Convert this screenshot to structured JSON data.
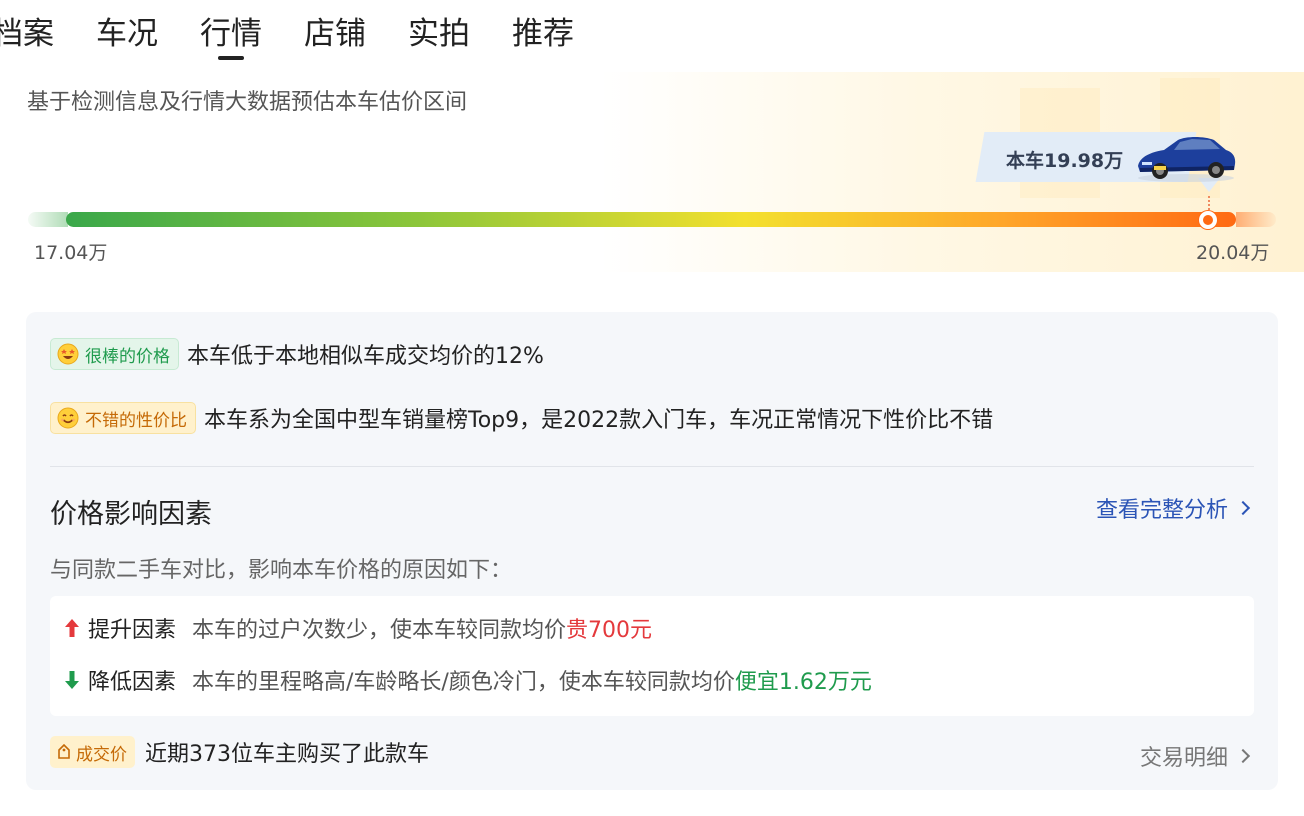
{
  "tabs": [
    {
      "label": "档案",
      "active": false
    },
    {
      "label": "车况",
      "active": false
    },
    {
      "label": "行情",
      "active": true
    },
    {
      "label": "店铺",
      "active": false
    },
    {
      "label": "实拍",
      "active": false
    },
    {
      "label": "推荐",
      "active": false
    }
  ],
  "estimate": {
    "description": "基于检测信息及行情大数据预估本车估价区间",
    "car_price_label": "本车19.98万",
    "range_min": "17.04万",
    "range_max": "20.04万",
    "car_price_position": 0.98
  },
  "rating": {
    "great_badge": "很棒的价格",
    "great_text": "本车低于本地相似车成交均价的12%",
    "value_badge": "不错的性价比",
    "value_text": "本车系为全国中型车销量榜Top9，是2022款入门车，车况正常情况下性价比不错"
  },
  "factors": {
    "title": "价格影响因素",
    "view_full": "查看完整分析",
    "compare_desc": "与同款二手车对比，影响本车价格的原因如下：",
    "up": {
      "label": "提升因素",
      "text": "本车的过户次数少，使本车较同款均价",
      "amount": "贵700元"
    },
    "down": {
      "label": "降低因素",
      "text": "本车的里程略高/车龄略长/颜色冷门，使本车较同款均价",
      "amount": "便宜1.62万元"
    }
  },
  "deal": {
    "badge": "成交价",
    "text": "近期373位车主购买了此款车",
    "detail": "交易明细"
  },
  "colors": {
    "accent_blue": "#2b54b6",
    "up_red": "#e4393c",
    "down_green": "#1f9b4d",
    "marker_orange": "#ff6a13"
  }
}
